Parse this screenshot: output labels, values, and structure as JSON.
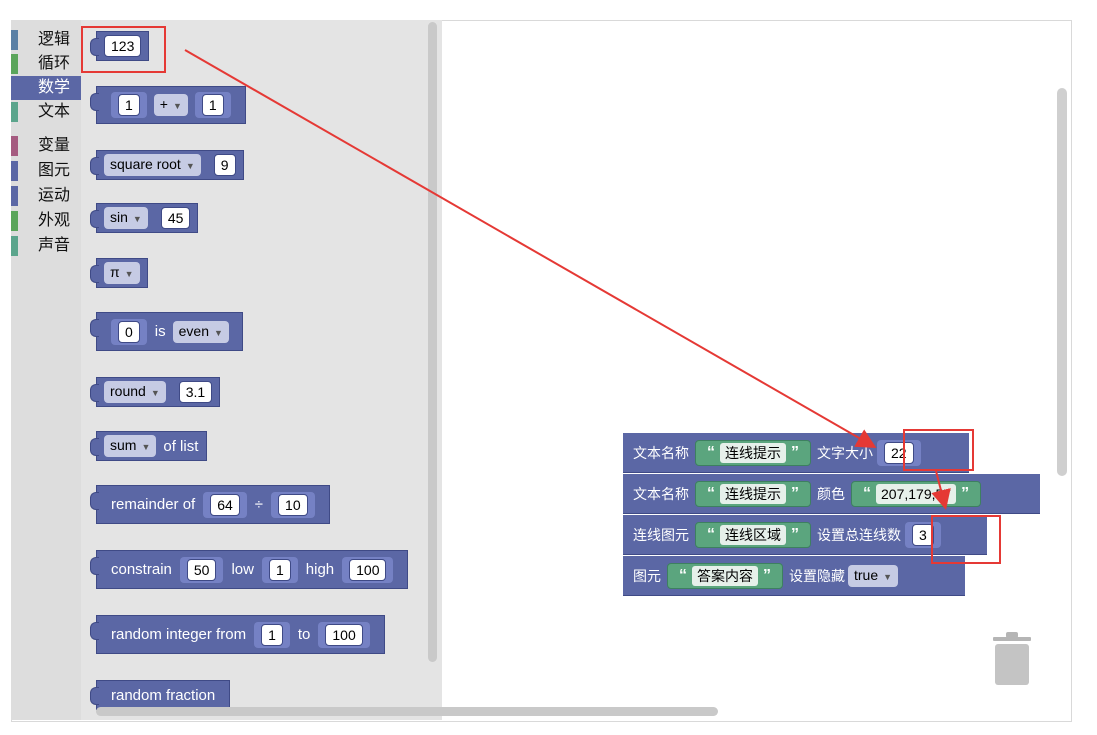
{
  "categories": [
    {
      "label": "逻辑",
      "color": "#5b80a5"
    },
    {
      "label": "循环",
      "color": "#5ba55b"
    },
    {
      "label": "数学",
      "color": "#5b67a5",
      "selected": true
    },
    {
      "label": "文本",
      "color": "#5ba58c"
    },
    {
      "label": "变量",
      "color": "#a55b80"
    },
    {
      "label": "图元",
      "color": "#5b67a5"
    },
    {
      "label": "运动",
      "color": "#5b67a5"
    },
    {
      "label": "外观",
      "color": "#5ba55b"
    },
    {
      "label": "声音",
      "color": "#5ba58c"
    }
  ],
  "flyout": {
    "number": "123",
    "arith": {
      "a": "1",
      "op": "+",
      "b": "1"
    },
    "single": {
      "fn": "square root",
      "v": "9"
    },
    "trig": {
      "fn": "sin",
      "v": "45"
    },
    "constant": {
      "c": "π"
    },
    "prop": {
      "v": "0",
      "is": "is",
      "prop": "even"
    },
    "round": {
      "fn": "round",
      "v": "3.1"
    },
    "list": {
      "fn": "sum",
      "of": "of list"
    },
    "remainder": {
      "label": "remainder of",
      "a": "64",
      "op": "÷",
      "b": "10"
    },
    "constrain": {
      "label": "constrain",
      "v": "50",
      "low_label": "low",
      "low": "1",
      "high_label": "high",
      "high": "100"
    },
    "randint": {
      "label": "random integer from",
      "from": "1",
      "to_label": "to",
      "to": "100"
    },
    "randfrac": {
      "label": "random fraction"
    }
  },
  "workspace": {
    "row1": {
      "name_label": "文本名称",
      "name_val": "连线提示",
      "size_label": "文字大小",
      "size_val": "22"
    },
    "row2": {
      "name_label": "文本名称",
      "name_val": "连线提示",
      "color_label": "颜色",
      "color_val": "207,179,57"
    },
    "row3": {
      "name_label": "连线图元",
      "name_val": "连线区域",
      "count_label": "设置总连线数",
      "count_val": "3"
    },
    "row4": {
      "name_label": "图元",
      "name_val": "答案内容",
      "hide_label": "设置隐藏",
      "hide_val": "true"
    }
  },
  "colors": {
    "math": "#5b67a5",
    "text": "#5ba57e",
    "annotation": "#e53935"
  }
}
